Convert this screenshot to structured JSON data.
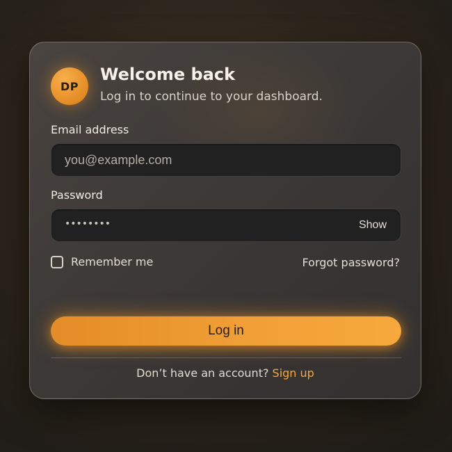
{
  "header": {
    "avatar_initials": "DP",
    "title": "Welcome back",
    "subtitle": "Log in to continue to your dashboard."
  },
  "form": {
    "email_label": "Email address",
    "email_placeholder": "you@example.com",
    "email_value": "",
    "password_label": "Password",
    "password_value_masked": "••••••••",
    "show_toggle_label": "Show",
    "remember_label": "Remember me",
    "remember_checked": false,
    "forgot_label": "Forgot password?",
    "submit_label": "Log in"
  },
  "footer": {
    "prompt": "Don’t have an account?",
    "signup_label": "Sign up"
  },
  "colors": {
    "accent": "#f1a037",
    "link": "#f6a93e",
    "card_bg": "#3f3b38",
    "input_bg": "#222121",
    "page_bg": "#2a241d"
  }
}
